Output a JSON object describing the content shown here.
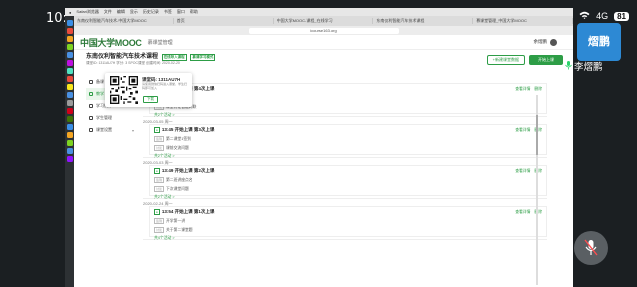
{
  "phone": {
    "time": "10:04",
    "signal": "4G",
    "battery": "81"
  },
  "meeting": {
    "participant_initials": "熠鹏",
    "participant_name": "李熠鹏"
  },
  "mac": {
    "menu": [
      "Safari浏览器",
      "文件",
      "编辑",
      "显示",
      "历史记录",
      "书签",
      "窗口",
      "帮助"
    ],
    "tabs": [
      "东南仪利智能汽车技术-中国大学MOOC",
      "首页",
      "中国大学MOOC-课程_在线学习",
      "东南仪利智能汽车技术课程",
      "慕课堂管理_中国大学MOOC"
    ],
    "url": "icourse163.org"
  },
  "site": {
    "logo": "中国大学MOOC",
    "logo_sub": "慕课堂管理",
    "user": "余熠鹏",
    "course": {
      "title": "东南仪利智能汽车技术课程",
      "meta": "课堂ID: 1311AU7H   学分: 3   SPOC课堂   创建时间: 2020-02-20",
      "badge1": "在线导入课程",
      "badge2": "慕课学习模式"
    },
    "buttons": {
      "create": "+新建课堂数据",
      "start": "开始上课"
    },
    "sidebar": [
      {
        "label": "备课",
        "active": false
      },
      {
        "label": "教学",
        "active": true
      },
      {
        "label": "学习统计",
        "active": false
      },
      {
        "label": "学生管理",
        "active": false
      },
      {
        "label": "课堂设置",
        "active": false
      }
    ],
    "popup": {
      "title": "课堂码: 1311AU7H",
      "desc": "请使用微信扫码进入课堂，学生扫码即可加入",
      "download": "下载"
    },
    "classes": [
      {
        "date": "",
        "title": "19:45 开始上课  第4次上课",
        "rows": [
          {
            "tag": "签到",
            "text": "签到"
          },
          {
            "tag": "讨论",
            "text": "课堂讨论智能网联"
          }
        ],
        "more": "共2个活动 >",
        "actions": [
          "查看详情",
          "删除"
        ]
      },
      {
        "date": "2020-03-05  周一",
        "title": "13:45 开始上课  第3次上课",
        "rows": [
          {
            "tag": "签到",
            "text": "第二课堂1签到"
          },
          {
            "tag": "讨论",
            "text": "课前交流问题"
          }
        ],
        "more": "共2个活动 >",
        "actions": [
          "查看详情",
          "删除"
        ]
      },
      {
        "date": "2020-03-03  周一",
        "title": "13:49 开始上课  第2次上课",
        "rows": [
          {
            "tag": "签到",
            "text": "第二班讲座点名"
          },
          {
            "tag": "讨论",
            "text": "下次课堂问题"
          }
        ],
        "more": "共2个活动 >",
        "actions": [
          "查看详情",
          "删除"
        ]
      },
      {
        "date": "2020-02-24  周一",
        "title": "13:54 开始上课  第1次上课",
        "rows": [
          {
            "tag": "签到",
            "text": "开学第一讲"
          },
          {
            "tag": "讨论",
            "text": "关于第二课堂题"
          }
        ],
        "more": "共4个活动 >",
        "actions": [
          "查看详情",
          "删除"
        ]
      }
    ]
  },
  "colors": {
    "brand_green": "#2d9d46",
    "avatar_blue": "#2d89d4",
    "mic_green": "#2bd46b"
  },
  "icons": {
    "mic": "microphone-muted-icon",
    "wifi": "wifi-icon",
    "battery": "battery-icon"
  }
}
